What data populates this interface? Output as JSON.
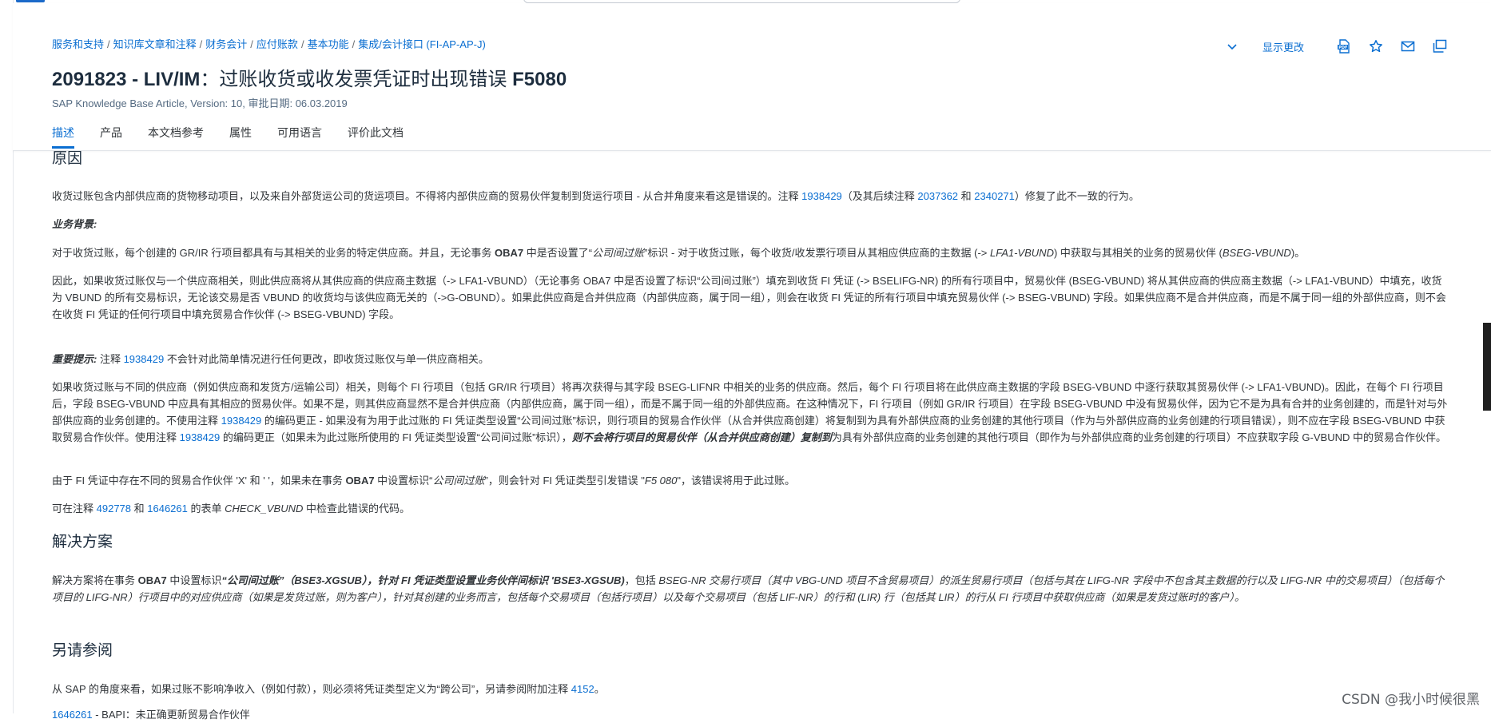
{
  "breadcrumb": [
    "服务和支持",
    "知识库文章和注释",
    "财务会计",
    "应付账款",
    "基本功能",
    "集成/会计接口 (FI-AP-AP-J)"
  ],
  "title": {
    "number": "2091823 - LIV/IM",
    "text": "：过账收货或收发票凭证时出现错误 ",
    "code": "F5080"
  },
  "meta": "SAP Knowledge Base Article, Version: 10, 审批日期: 06.03.2019",
  "tabs": [
    "描述",
    "产品",
    "本文档参考",
    "属性",
    "可用语言",
    "评价此文档"
  ],
  "actions": {
    "show_changes": "显示更改"
  },
  "icons": [
    "chevron-down-icon",
    "pdf-icon",
    "star-icon",
    "mail-icon",
    "copy-icon"
  ],
  "cause": {
    "heading": "原因",
    "p1a": "收货过账包含内部供应商的货物移动项目，以及来自外部货运公司的货运项目。不得将内部供应商的贸易伙伴复制到货运行项目 - 从合并角度来看这是错误的。注释 ",
    "note1": "1938429",
    "p1b": "（及其后续注释 ",
    "note2": "2037362",
    "p1c": " 和 ",
    "note3": "2340271",
    "p1d": "）修复了此不一致的行为。",
    "bg_label": "业务背景:",
    "p2a": "对于收货过账，每个创建的 GR/IR 行项目都具有与其相关的业务的特定供应商。并且，无论事务 ",
    "p2b": "OBA7",
    "p2c": " 中是否设置了“",
    "p2d": "公司间过账",
    "p2e": "”标识 - 对于收货过账，每个收货/收发票行项目从其相应供应商的主数据 (-> ",
    "p2f": "LFA1-VBUND",
    "p2g": ") 中获取与其相关的业务的贸易伙伴 (",
    "p2h": "BSEG-VBUND",
    "p2i": ")。",
    "p3": "因此，如果收货过账仅与一个供应商相关，则此供应商将从其供应商的供应商主数据（-> LFA1-VBUND）（无论事务 OBA7 中是否设置了标识“公司间过账”）填充到收货 FI 凭证 (-> BSELIFG-NR) 的所有行项目中，贸易伙伴 (BSEG-VBUND) 将从其供应商的供应商主数据（-> LFA1-VBUND）中填充，收货为 VBUND 的所有交易标识，无论该交易是否 VBUND 的收货均与该供应商无关的（->G-OBUND）。如果此供应商是合并供应商（内部供应商，属于同一组），则会在收货 FI 凭证的所有行项目中填充贸易伙伴 (-> BSEG-VBUND) 字段。如果供应商不是合并供应商，而是不属于同一组的外部供应商，则不会在收货 FI 凭证的任何行项目中填充贸易合作伙伴 (-> BSEG-VBUND) 字段。",
    "imp_label": "重要提示:",
    "p4a": " 注释 ",
    "p4note": "1938429",
    "p4b": " 不会针对此简单情况进行任何更改，即收货过账仅与单一供应商相关。",
    "p5a": "如果收货过账与不同的供应商（例如供应商和发货方/运输公司）相关，则每个 FI 行项目（包括 GR/IR 行项目）将再次获得与其字段 BSEG-LIFNR 中相关的业务的供应商。然后，每个 FI 行项目将在此供应商主数据的字段 BSEG-VBUND 中逐行获取其贸易伙伴 (-> LFA1-VBUND)。因此，在每个 FI 行项目后，字段 BSEG-VBUND 中应具有其相应的贸易伙伴。如果不是，则其供应商显然不是合并供应商（内部供应商，属于同一组），而是不属于同一组的外部供应商。在这种情况下，FI 行项目（例如 GR/IR 行项目）在字段 BSEG-VBUND 中没有贸易伙伴，因为它不是为具有合并的业务创建的，而是针对与外部供应商的业务创建的。不使用注释 ",
    "p5note1": "1938429",
    "p5b": " 的编码更正 - 如果没有为用于此过账的 FI 凭证类型设置“公司间过账”标识，则行项目的贸易合作伙伴（从合并供应商创建）将复制到为具有外部供应商的业务创建的其他行项目（作为与外部供应商的业务创建的行项目错误），则不应在字段 BSEG-VBUND 中获取贸易合作伙伴。使用注释 ",
    "p5note2": "1938429",
    "p5c": " 的编码更正（如果未为此过账所使用的 FI 凭证类型设置“公司间过账”标识），",
    "p5bold": "则不会将行项目的贸易伙伴（从合并供应商创建）复制到",
    "p5d": "为具有外部供应商的业务创建的其他行项目（即作为与外部供应商的业务创建的行项目）不应获取字段 G-VBUND 中的贸易合作伙伴。",
    "p6a": "由于 FI 凭证中存在不同的贸易合作伙伴 'X' 和 ' '，如果未在事务 ",
    "p6b": "OBA7",
    "p6c": " 中设置标识“",
    "p6d": "公司间过账",
    "p6e": "”，则会针对 FI 凭证类型引发错误 \"",
    "p6f": "F5 080",
    "p6g": "\"，该错误将用于此过账。",
    "p7a": "可在注释 ",
    "p7note1": "492778",
    "p7b": " 和 ",
    "p7note2": "1646261",
    "p7c": " 的表单 ",
    "p7d": "CHECK_VBUND",
    "p7e": " 中检查此错误的代码。"
  },
  "solution": {
    "heading": "解决方案",
    "p1a": "解决方案将在事务 ",
    "p1b": "OBA7",
    "p1c": " 中设置标识",
    "p1d": "“公司间过账”（BSE3-XGSUB），针对 FI 凭证类型设置业务伙伴间标识 'BSE3-XGSUB)",
    "p1e": "，包括 ",
    "p1f": "BSEG-NR 交易行项目（其中 VBG-UND 项目不含贸易项目）的派生贸易行项目（包括与其在 LIFG-NR 字段中不包含其主数据的行以及 LIFG-NR 中的交易项目）（包括每个项目的 LIFG-NR）行项目中的对应供应商（如果是发货过账，则为客户），针对其创建的业务而言，包括每个交易项目（包括行项目）以及每个交易项目（包括 LIF-NR）的行和 (LIR) 行（包括其 LIR）的行从 FI 行项目中获取供应商（如果是发货过账时的客户）。"
  },
  "seealso": {
    "heading": "另请参阅",
    "p1a": "从 SAP 的角度来看，如果过账不影响净收入（例如付款），则必须将凭证类型定义为“跨公司”，另请参阅附加注释 ",
    "p1note": "4152",
    "p1b": "。",
    "p2note": "1646261",
    "p2text": " - BAPI：未正确更新贸易合作伙伴"
  },
  "watermark": "CSDN @我小时候很黑"
}
